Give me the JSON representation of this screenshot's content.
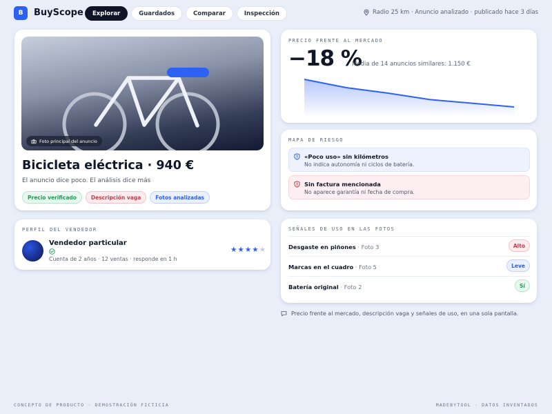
{
  "app": {
    "logo_letter": "B",
    "name": "BuyScope"
  },
  "nav": {
    "tabs": [
      {
        "label": "Explorar",
        "active": true
      },
      {
        "label": "Guardados",
        "active": false
      },
      {
        "label": "Comparar",
        "active": false
      },
      {
        "label": "Inspección",
        "active": false
      }
    ]
  },
  "context": {
    "icon": "map-pin-icon",
    "text": "Radio 25 km · Anuncio analizado · publicado hace 3 días"
  },
  "listing": {
    "photo_caption": "Foto principal del anuncio",
    "title": "Bicicleta eléctrica · 940 €",
    "subtitle": "El anuncio dice poco. El análisis dice más",
    "tags": [
      {
        "label": "Precio verificado",
        "tone": "green"
      },
      {
        "label": "Descripción vaga",
        "tone": "red"
      },
      {
        "label": "Fotos analizadas",
        "tone": "blue"
      }
    ]
  },
  "seller": {
    "kicker": "Perfil del vendedor",
    "name": "Vendedor particular",
    "meta": "Cuenta de 2 años · 12 ventas · responde en 1 h",
    "rating": 4,
    "rating_max": 5
  },
  "price": {
    "kicker": "Precio frente al mercado",
    "delta": "−18 %",
    "median": "Media de 14 anuncios similares: 1.150 €",
    "trend": [
      100,
      82,
      70,
      56,
      48,
      40
    ]
  },
  "risk": {
    "kicker": "Mapa de riesgo",
    "items": [
      {
        "title": "«Poco uso» sin kilómetros",
        "desc": "No indica autonomía ni ciclos de batería.",
        "tone": "blue",
        "icon": "shield-icon"
      },
      {
        "title": "Sin factura mencionada",
        "desc": "No aparece garantía ni fecha de compra.",
        "tone": "red",
        "icon": "shield-alert-icon"
      }
    ]
  },
  "usage": {
    "kicker": "Señales de uso en las fotos",
    "rows": [
      {
        "label": "Desgaste en piñones",
        "source": " · Foto 3",
        "badge": "Alto",
        "tone": "red"
      },
      {
        "label": "Marcas en el cuadro",
        "source": " · Foto 5",
        "badge": "Leve",
        "tone": "blue"
      },
      {
        "label": "Batería original",
        "source": " · Foto 2",
        "badge": "Sí",
        "tone": "green"
      }
    ]
  },
  "note": "Precio frente al mercado, descripción vaga y señales de uso, en una sola pantalla.",
  "footer": {
    "left": "Concepto de producto · Demostración ficticia",
    "right": "MadeByTool · Datos inventados"
  },
  "colors": {
    "accent": "#2c61f1",
    "dark": "#0d1526",
    "background": "#e9eef9"
  }
}
